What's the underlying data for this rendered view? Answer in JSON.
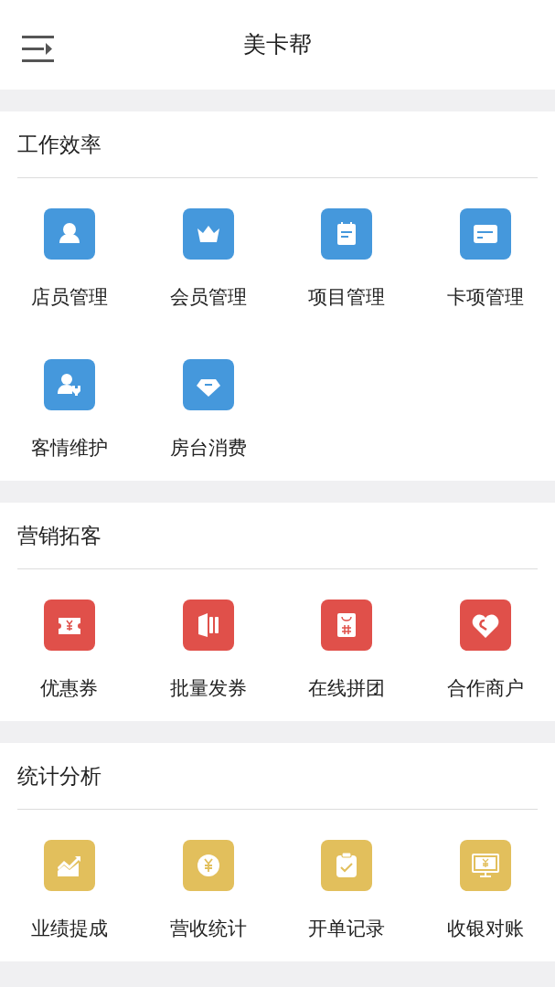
{
  "header": {
    "title": "美卡帮"
  },
  "sections": [
    {
      "title": "工作效率",
      "color": "#4598dc",
      "items": [
        {
          "label": "店员管理"
        },
        {
          "label": "会员管理"
        },
        {
          "label": "项目管理"
        },
        {
          "label": "卡项管理"
        },
        {
          "label": "客情维护"
        },
        {
          "label": "房台消费"
        }
      ]
    },
    {
      "title": "营销拓客",
      "color": "#e0504a",
      "items": [
        {
          "label": "优惠券"
        },
        {
          "label": "批量发券"
        },
        {
          "label": "在线拼团"
        },
        {
          "label": "合作商户"
        }
      ]
    },
    {
      "title": "统计分析",
      "color": "#e2bf5c",
      "items": [
        {
          "label": "业绩提成"
        },
        {
          "label": "营收统计"
        },
        {
          "label": "开单记录"
        },
        {
          "label": "收银对账"
        }
      ]
    }
  ]
}
